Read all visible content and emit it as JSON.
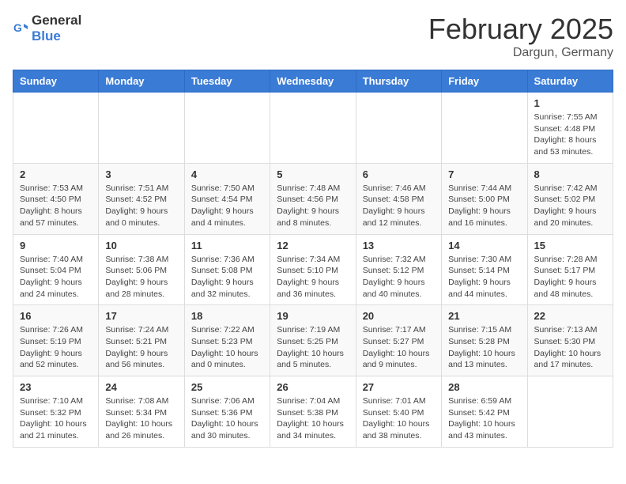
{
  "header": {
    "logo_general": "General",
    "logo_blue": "Blue",
    "month_title": "February 2025",
    "location": "Dargun, Germany"
  },
  "days_of_week": [
    "Sunday",
    "Monday",
    "Tuesday",
    "Wednesday",
    "Thursday",
    "Friday",
    "Saturday"
  ],
  "weeks": [
    [
      {
        "day": "",
        "info": ""
      },
      {
        "day": "",
        "info": ""
      },
      {
        "day": "",
        "info": ""
      },
      {
        "day": "",
        "info": ""
      },
      {
        "day": "",
        "info": ""
      },
      {
        "day": "",
        "info": ""
      },
      {
        "day": "1",
        "info": "Sunrise: 7:55 AM\nSunset: 4:48 PM\nDaylight: 8 hours and 53 minutes."
      }
    ],
    [
      {
        "day": "2",
        "info": "Sunrise: 7:53 AM\nSunset: 4:50 PM\nDaylight: 8 hours and 57 minutes."
      },
      {
        "day": "3",
        "info": "Sunrise: 7:51 AM\nSunset: 4:52 PM\nDaylight: 9 hours and 0 minutes."
      },
      {
        "day": "4",
        "info": "Sunrise: 7:50 AM\nSunset: 4:54 PM\nDaylight: 9 hours and 4 minutes."
      },
      {
        "day": "5",
        "info": "Sunrise: 7:48 AM\nSunset: 4:56 PM\nDaylight: 9 hours and 8 minutes."
      },
      {
        "day": "6",
        "info": "Sunrise: 7:46 AM\nSunset: 4:58 PM\nDaylight: 9 hours and 12 minutes."
      },
      {
        "day": "7",
        "info": "Sunrise: 7:44 AM\nSunset: 5:00 PM\nDaylight: 9 hours and 16 minutes."
      },
      {
        "day": "8",
        "info": "Sunrise: 7:42 AM\nSunset: 5:02 PM\nDaylight: 9 hours and 20 minutes."
      }
    ],
    [
      {
        "day": "9",
        "info": "Sunrise: 7:40 AM\nSunset: 5:04 PM\nDaylight: 9 hours and 24 minutes."
      },
      {
        "day": "10",
        "info": "Sunrise: 7:38 AM\nSunset: 5:06 PM\nDaylight: 9 hours and 28 minutes."
      },
      {
        "day": "11",
        "info": "Sunrise: 7:36 AM\nSunset: 5:08 PM\nDaylight: 9 hours and 32 minutes."
      },
      {
        "day": "12",
        "info": "Sunrise: 7:34 AM\nSunset: 5:10 PM\nDaylight: 9 hours and 36 minutes."
      },
      {
        "day": "13",
        "info": "Sunrise: 7:32 AM\nSunset: 5:12 PM\nDaylight: 9 hours and 40 minutes."
      },
      {
        "day": "14",
        "info": "Sunrise: 7:30 AM\nSunset: 5:14 PM\nDaylight: 9 hours and 44 minutes."
      },
      {
        "day": "15",
        "info": "Sunrise: 7:28 AM\nSunset: 5:17 PM\nDaylight: 9 hours and 48 minutes."
      }
    ],
    [
      {
        "day": "16",
        "info": "Sunrise: 7:26 AM\nSunset: 5:19 PM\nDaylight: 9 hours and 52 minutes."
      },
      {
        "day": "17",
        "info": "Sunrise: 7:24 AM\nSunset: 5:21 PM\nDaylight: 9 hours and 56 minutes."
      },
      {
        "day": "18",
        "info": "Sunrise: 7:22 AM\nSunset: 5:23 PM\nDaylight: 10 hours and 0 minutes."
      },
      {
        "day": "19",
        "info": "Sunrise: 7:19 AM\nSunset: 5:25 PM\nDaylight: 10 hours and 5 minutes."
      },
      {
        "day": "20",
        "info": "Sunrise: 7:17 AM\nSunset: 5:27 PM\nDaylight: 10 hours and 9 minutes."
      },
      {
        "day": "21",
        "info": "Sunrise: 7:15 AM\nSunset: 5:28 PM\nDaylight: 10 hours and 13 minutes."
      },
      {
        "day": "22",
        "info": "Sunrise: 7:13 AM\nSunset: 5:30 PM\nDaylight: 10 hours and 17 minutes."
      }
    ],
    [
      {
        "day": "23",
        "info": "Sunrise: 7:10 AM\nSunset: 5:32 PM\nDaylight: 10 hours and 21 minutes."
      },
      {
        "day": "24",
        "info": "Sunrise: 7:08 AM\nSunset: 5:34 PM\nDaylight: 10 hours and 26 minutes."
      },
      {
        "day": "25",
        "info": "Sunrise: 7:06 AM\nSunset: 5:36 PM\nDaylight: 10 hours and 30 minutes."
      },
      {
        "day": "26",
        "info": "Sunrise: 7:04 AM\nSunset: 5:38 PM\nDaylight: 10 hours and 34 minutes."
      },
      {
        "day": "27",
        "info": "Sunrise: 7:01 AM\nSunset: 5:40 PM\nDaylight: 10 hours and 38 minutes."
      },
      {
        "day": "28",
        "info": "Sunrise: 6:59 AM\nSunset: 5:42 PM\nDaylight: 10 hours and 43 minutes."
      },
      {
        "day": "",
        "info": ""
      }
    ]
  ]
}
